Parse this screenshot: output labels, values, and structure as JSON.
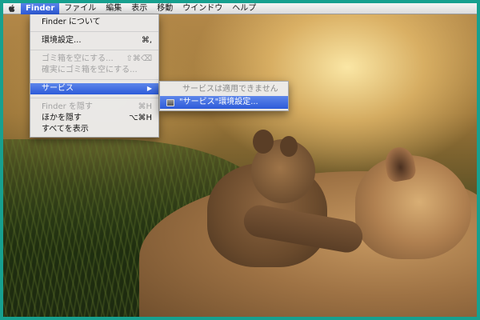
{
  "menubar": {
    "apple_icon": "apple-icon",
    "items": [
      {
        "label": "Finder"
      },
      {
        "label": "ファイル"
      },
      {
        "label": "編集"
      },
      {
        "label": "表示"
      },
      {
        "label": "移動"
      },
      {
        "label": "ウインドウ"
      },
      {
        "label": "ヘルプ"
      }
    ]
  },
  "finder_menu": {
    "about": "Finder について",
    "preferences": {
      "label": "環境設定...",
      "shortcut": "⌘,"
    },
    "empty_trash": {
      "label": "ゴミ箱を空にする...",
      "shortcut": "⇧⌘⌫"
    },
    "secure_empty_trash": {
      "label": "確実にゴミ箱を空にする..."
    },
    "services": {
      "label": "サービス",
      "arrow": "▶"
    },
    "hide_finder": {
      "label": "Finder を隠す",
      "shortcut": "⌘H"
    },
    "hide_others": {
      "label": "ほかを隠す",
      "shortcut": "⌥⌘H"
    },
    "show_all": {
      "label": "すべてを表示"
    }
  },
  "services_submenu": {
    "no_services": "サービスは適用できません",
    "services_preferences": "\"サービス\"環境設定..."
  },
  "colors": {
    "highlight": "#2d5bd9",
    "frame": "#17a08f"
  }
}
